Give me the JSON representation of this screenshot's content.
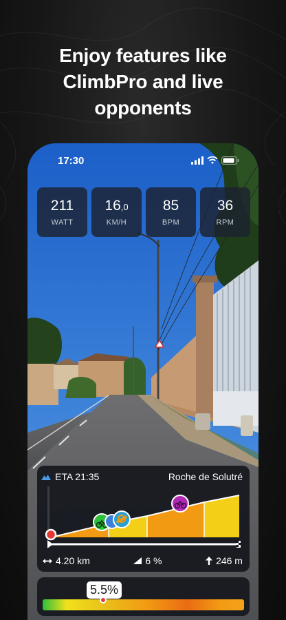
{
  "headline": "Enjoy features like\nClimbPro and live\nopponents",
  "status_bar": {
    "time": "17:30",
    "icons": [
      "signal-icon",
      "wifi-icon",
      "battery-icon"
    ]
  },
  "metrics": [
    {
      "value": "211",
      "decimal": "",
      "unit": "WATT"
    },
    {
      "value": "16",
      "decimal": ",0",
      "unit": "KM/H"
    },
    {
      "value": "85",
      "decimal": "",
      "unit": "BPM"
    },
    {
      "value": "36",
      "decimal": "",
      "unit": "RPM"
    }
  ],
  "climb": {
    "eta_label": "ETA 21:35",
    "name": "Roche de Solutré",
    "distance": "4.20 km",
    "gradient": "6 %",
    "elevation": "246 m",
    "icons": [
      "mountain-icon",
      "distance-arrows-icon",
      "gradient-icon",
      "up-arrow-icon"
    ]
  },
  "grade": {
    "value": "5.5%"
  },
  "colors": {
    "accent_blue": "#4a9be8",
    "segment_orange": "#f29a12",
    "segment_yellow": "#f3cf18",
    "opponent_green": "#2fbf3b",
    "opponent_purple": "#b02ab5",
    "marker_red": "#e53935"
  }
}
